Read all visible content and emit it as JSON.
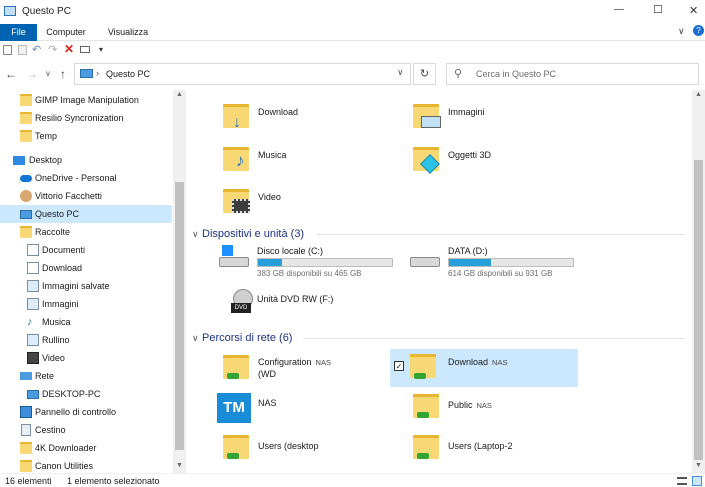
{
  "window": {
    "title": "Questo PC",
    "minimize_glyph": "—",
    "maximize_glyph": "☐",
    "close_glyph": "✕"
  },
  "ribbon": {
    "tabs": [
      "File",
      "Computer",
      "Visualizza"
    ],
    "help_glyph": "?",
    "expand_glyph": "∨"
  },
  "address": {
    "path": "Questo PC",
    "search_placeholder": "Cerca in Questo PC"
  },
  "sidebar": {
    "items": [
      {
        "label": "GIMP Image Manipulation",
        "icon": "folder-icon"
      },
      {
        "label": "Resilio Syncronization",
        "icon": "folder-icon"
      },
      {
        "label": "Temp",
        "icon": "folder-icon"
      },
      {
        "label": "Desktop",
        "icon": "desktop-icon"
      },
      {
        "label": "OneDrive - Personal",
        "icon": "onedrive-icon"
      },
      {
        "label": "Vittorio Facchetti",
        "icon": "user-icon"
      },
      {
        "label": "Questo PC",
        "icon": "computer-icon"
      },
      {
        "label": "Raccolte",
        "icon": "libraries-icon"
      },
      {
        "label": "Documenti",
        "icon": "documents-icon"
      },
      {
        "label": "Download",
        "icon": "download-icon"
      },
      {
        "label": "Immagini salvate",
        "icon": "pictures-icon"
      },
      {
        "label": "Immagini",
        "icon": "pictures-icon"
      },
      {
        "label": "Musica",
        "icon": "music-icon"
      },
      {
        "label": "Rullino",
        "icon": "pictures-icon"
      },
      {
        "label": "Video",
        "icon": "video-icon"
      },
      {
        "label": "Rete",
        "icon": "network-icon"
      },
      {
        "label": "DESKTOP-PC",
        "icon": "computer-icon"
      },
      {
        "label": "Pannello di controllo",
        "icon": "control-panel-icon"
      },
      {
        "label": "Cestino",
        "icon": "recycle-bin-icon"
      },
      {
        "label": "4K Downloader",
        "icon": "folder-icon"
      },
      {
        "label": "Canon Utilities",
        "icon": "folder-icon"
      }
    ]
  },
  "folders": [
    {
      "label": "Download",
      "icon": "download-folder-icon"
    },
    {
      "label": "Immagini",
      "icon": "pictures-folder-icon"
    },
    {
      "label": "Musica",
      "icon": "music-folder-icon"
    },
    {
      "label": "Oggetti 3D",
      "icon": "3d-objects-folder-icon"
    },
    {
      "label": "Video",
      "icon": "video-folder-icon"
    }
  ],
  "sections": {
    "devices": "Dispositivi e unità (3)",
    "network": "Percorsi di rete (6)"
  },
  "drives": [
    {
      "label": "Disco locale (C:)",
      "free": "383 GB disponibili su 465 GB",
      "used_fraction": 0.18
    },
    {
      "label": "DATA (D:)",
      "free": "614 GB disponibili su 931 GB",
      "used_fraction": 0.34
    },
    {
      "label": "Unità DVD RW (F:)"
    }
  ],
  "network": [
    {
      "label": "Configuration",
      "tag": "NAS",
      "label2": "(WD"
    },
    {
      "label": "Download",
      "tag": "NAS",
      "selected": true
    },
    {
      "label": "NAS",
      "tag": ""
    },
    {
      "label": "Public",
      "tag": "NAS"
    },
    {
      "label": "Users (desktop",
      "tag": ""
    },
    {
      "label": "Users (Laptop-2",
      "tag": ""
    }
  ],
  "status": {
    "count": "16 elementi",
    "selected": "1 elemento selezionato"
  },
  "colors": {
    "accent": "#0063b1",
    "bar": "#26a0da",
    "selection": "#cce8ff"
  }
}
